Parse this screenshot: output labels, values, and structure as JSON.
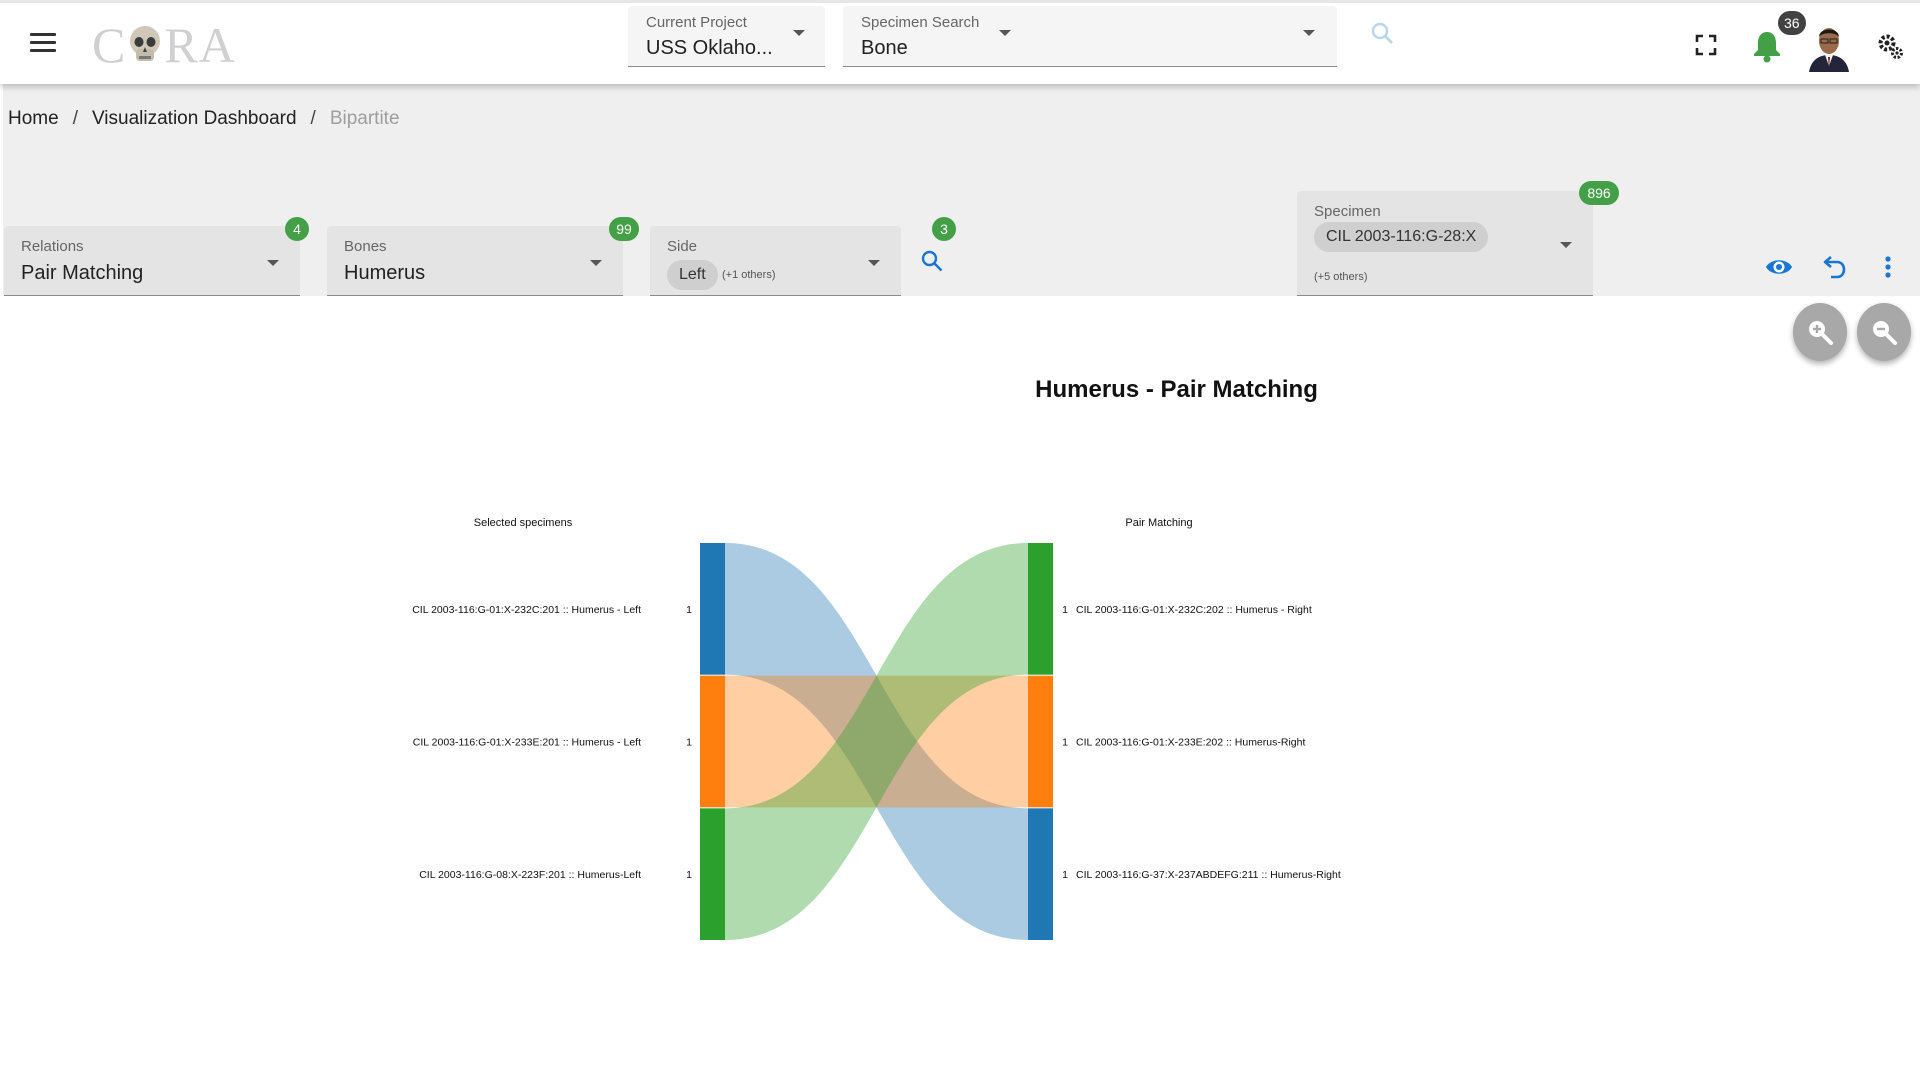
{
  "app": {
    "logo_text_left": "C",
    "logo_text_right": "RA"
  },
  "topbar": {
    "current_project": {
      "label": "Current Project",
      "value": "USS Oklaho..."
    },
    "specimen_search": {
      "label": "Specimen Search",
      "value": "Bone"
    },
    "notifications_count": "36"
  },
  "breadcrumb": {
    "home": "Home",
    "dashboard": "Visualization Dashboard",
    "current": "Bipartite"
  },
  "filters": {
    "relations": {
      "label": "Relations",
      "value": "Pair Matching",
      "badge": "4"
    },
    "bones": {
      "label": "Bones",
      "value": "Humerus",
      "badge": "99"
    },
    "side": {
      "label": "Side",
      "chip": "Left",
      "others": "(+1 others)",
      "badge": "3"
    },
    "specimen": {
      "label": "Specimen",
      "chip": "CIL 2003-116:G-28:X",
      "others": "(+5 others)",
      "badge": "896"
    }
  },
  "colors": {
    "badge_green": "#43a047",
    "blue": "#1f77b4",
    "orange": "#ff7f0e",
    "green": "#2ca02c",
    "action_blue": "#1976d2"
  },
  "chart_data": {
    "type": "bipartite",
    "title": "Humerus - Pair Matching",
    "left_header": "Selected specimens",
    "right_header": "Pair Matching",
    "left_nodes": [
      {
        "label": "CIL 2003-116:G-01:X-232C:201 :: Humerus - Left",
        "value": 1,
        "color": "#1f77b4"
      },
      {
        "label": "CIL 2003-116:G-01:X-233E:201 :: Humerus - Left",
        "value": 1,
        "color": "#ff7f0e"
      },
      {
        "label": "CIL 2003-116:G-08:X-223F:201 :: Humerus-Left",
        "value": 1,
        "color": "#2ca02c"
      }
    ],
    "right_nodes": [
      {
        "label": "CIL 2003-116:G-01:X-232C:202 :: Humerus - Right",
        "value": 1,
        "color": "#2ca02c"
      },
      {
        "label": "CIL 2003-116:G-01:X-233E:202 :: Humerus-Right",
        "value": 1,
        "color": "#ff7f0e"
      },
      {
        "label": "CIL 2003-116:G-37:X-237ABDEFG:211 :: Humerus-Right",
        "value": 1,
        "color": "#1f77b4"
      }
    ],
    "links": [
      {
        "source": 0,
        "target": 2,
        "value": 1,
        "color": "#1f77b4"
      },
      {
        "source": 1,
        "target": 1,
        "value": 1,
        "color": "#ff7f0e"
      },
      {
        "source": 2,
        "target": 0,
        "value": 1,
        "color": "#2ca02c"
      }
    ]
  }
}
